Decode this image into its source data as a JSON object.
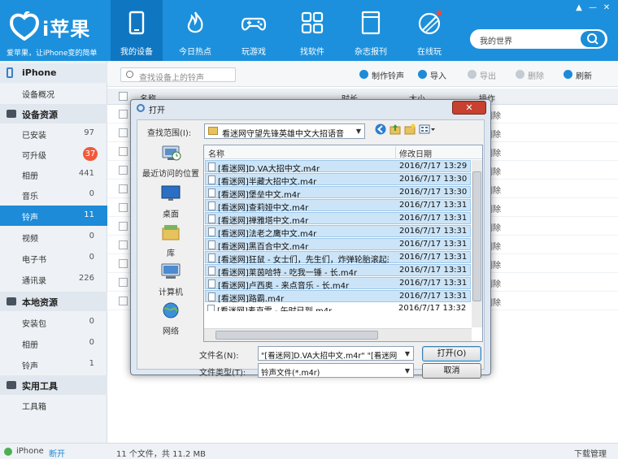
{
  "app": {
    "name": "i苹果",
    "slogan": "爱苹果，让iPhone变的简单",
    "brand_color": "#1c90dc",
    "window_controls": [
      "▲",
      "—",
      "✕"
    ],
    "global_search_value": "我的世界"
  },
  "nav": {
    "tabs": [
      {
        "label": "我的设备",
        "icon": "phone-icon",
        "active": true
      },
      {
        "label": "今日热点",
        "icon": "flame-icon"
      },
      {
        "label": "玩游戏",
        "icon": "gamepad-icon"
      },
      {
        "label": "找软件",
        "icon": "apps-grid-icon"
      },
      {
        "label": "杂志报刊",
        "icon": "book-icon"
      },
      {
        "label": "在线玩",
        "icon": "online-play-icon"
      }
    ]
  },
  "sidebar": {
    "device": "iPhone",
    "overview": "设备概况",
    "sections": [
      {
        "title": "设备资源",
        "icon": "grid-icon",
        "items": [
          {
            "label": "已安装",
            "count": "97"
          },
          {
            "label": "可升级",
            "count": "37",
            "badge": true
          },
          {
            "label": "相册",
            "count": "441"
          },
          {
            "label": "音乐",
            "count": "0"
          },
          {
            "label": "铃声",
            "count": "11",
            "active": true
          },
          {
            "label": "视频",
            "count": "0"
          },
          {
            "label": "电子书",
            "count": "0"
          },
          {
            "label": "通讯录",
            "count": "226"
          }
        ]
      },
      {
        "title": "本地资源",
        "icon": "monitor-icon",
        "items": [
          {
            "label": "安装包",
            "count": "0"
          },
          {
            "label": "相册",
            "count": "0"
          },
          {
            "label": "铃声",
            "count": "1"
          }
        ]
      },
      {
        "title": "实用工具",
        "icon": "toolbox-icon",
        "items": [
          {
            "label": "工具箱",
            "count": ""
          }
        ]
      }
    ]
  },
  "toolbar": {
    "search_placeholder": "查找设备上的铃声",
    "make_ringtone": "制作铃声",
    "import": "导入",
    "export": "导出",
    "delete": "删除",
    "refresh": "刷新"
  },
  "list": {
    "columns": {
      "name": "名称",
      "duration": "时长",
      "size": "大小",
      "action": "操作"
    },
    "row_action": "删除",
    "row_count": 11
  },
  "status": {
    "device": "iPhone",
    "connection": "断开",
    "summary": "11 个文件，共 11.2 MB",
    "downloads": "下载管理"
  },
  "dialog": {
    "title": "打开",
    "close": "✕",
    "lookin_label": "查找范围(I):",
    "lookin_value": "看迷网守望先锋英雄中文大招语音",
    "places": [
      {
        "label": "最近访问的位置",
        "icon": "recent-places-icon"
      },
      {
        "label": "桌面",
        "icon": "desktop-icon"
      },
      {
        "label": "库",
        "icon": "library-icon"
      },
      {
        "label": "计算机",
        "icon": "computer-icon"
      },
      {
        "label": "网络",
        "icon": "network-icon"
      }
    ],
    "columns": {
      "name": "名称",
      "date": "修改日期"
    },
    "files": [
      {
        "name": "[看迷网]D.VA大招中文.m4r",
        "date": "2016/7/17 13:29"
      },
      {
        "name": "[看迷网]半藏大招中文.m4r",
        "date": "2016/7/17 13:30"
      },
      {
        "name": "[看迷网]堡垒中文.m4r",
        "date": "2016/7/17 13:30"
      },
      {
        "name": "[看迷网]查莉娅中文.m4r",
        "date": "2016/7/17 13:31"
      },
      {
        "name": "[看迷网]禅雅塔中文.m4r",
        "date": "2016/7/17 13:31"
      },
      {
        "name": "[看迷网]法老之鹰中文.m4r",
        "date": "2016/7/17 13:31"
      },
      {
        "name": "[看迷网]黑百合中文.m4r",
        "date": "2016/7/17 13:31"
      },
      {
        "name": "[看迷网]狂鼠 - 女士们，先生们，炸弹轮胎滚起来...",
        "date": "2016/7/17 13:31"
      },
      {
        "name": "[看迷网]莱茵哈特 - 吃我一锤 - 长.m4r",
        "date": "2016/7/17 13:31"
      },
      {
        "name": "[看迷网]卢西奥 - 来点音乐 - 长.m4r",
        "date": "2016/7/17 13:31"
      },
      {
        "name": "[看迷网]路霸.m4r",
        "date": "2016/7/17 13:31"
      },
      {
        "name": "[看迷网]麦克雷 - 午时已到.m4r",
        "date": "2016/7/17 13:32"
      }
    ],
    "filename_label": "文件名(N):",
    "filename_value": "\"[看迷网]D.VA大招中文.m4r\" \"[看迷网]半",
    "filetype_label": "文件类型(T):",
    "filetype_value": "铃声文件(*.m4r)",
    "open_button": "打开(O)",
    "cancel_button": "取消"
  }
}
